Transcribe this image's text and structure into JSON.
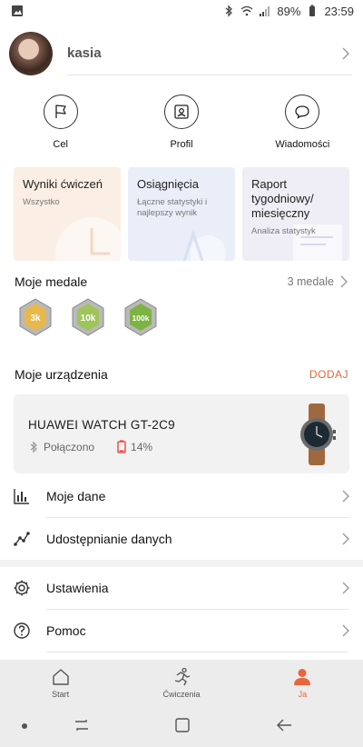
{
  "status_bar": {
    "battery": "89%",
    "time": "23:59"
  },
  "profile": {
    "username": "kasia"
  },
  "quick_actions": [
    {
      "label": "Cel",
      "icon": "flag-icon"
    },
    {
      "label": "Profil",
      "icon": "profile-card-icon"
    },
    {
      "label": "Wiadomości",
      "icon": "chat-bubble-icon"
    }
  ],
  "cards": [
    {
      "title": "Wyniki ćwiczeń",
      "subtitle": "Wszystko"
    },
    {
      "title": "Osiągnięcia",
      "subtitle": "Łączne statystyki i najlepszy wynik"
    },
    {
      "title": "Raport tygodniowy/ miesięczny",
      "subtitle": "Analiza statystyk"
    }
  ],
  "medals": {
    "title": "Moje medale",
    "count": "3 medale",
    "items": [
      "3k",
      "10k",
      "100k"
    ]
  },
  "devices": {
    "title": "Moje urządzenia",
    "add": "DODAJ",
    "device": {
      "name": "HUAWEI WATCH GT-2C9",
      "connection": "Połączono",
      "battery": "14%",
      "battery_level": 0.14
    }
  },
  "menu": [
    {
      "label": "Moje dane",
      "icon": "bar-chart-icon"
    },
    {
      "label": "Udostępnianie danych",
      "icon": "share-data-icon"
    },
    {
      "label": "Ustawienia",
      "icon": "gear-icon"
    },
    {
      "label": "Pomoc",
      "icon": "help-icon"
    }
  ],
  "bottom_nav": [
    {
      "label": "Start",
      "icon": "home-icon",
      "active": false
    },
    {
      "label": "Ćwiczenia",
      "icon": "running-icon",
      "active": false
    },
    {
      "label": "Ja",
      "icon": "person-icon",
      "active": true
    }
  ],
  "colors": {
    "accent": "#e8663a",
    "battery_low": "#e53935"
  }
}
